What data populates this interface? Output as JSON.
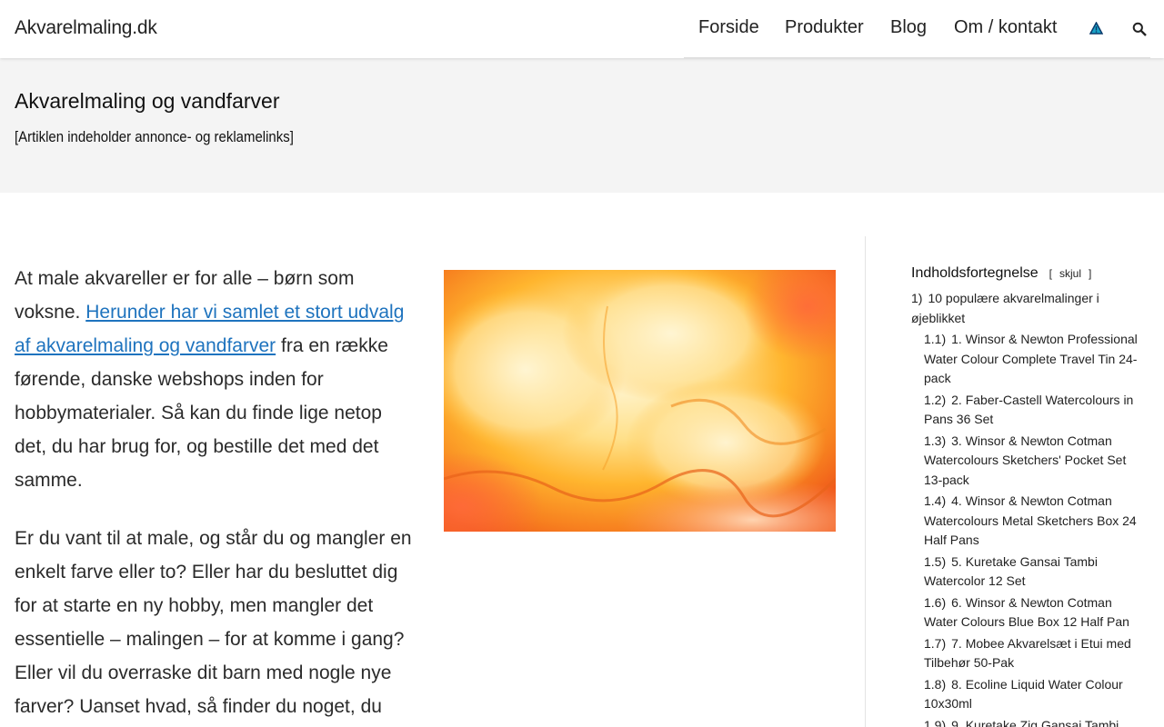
{
  "site": {
    "logo": "Akvarelmaling.dk"
  },
  "nav": {
    "items": [
      "Forside",
      "Produkter",
      "Blog",
      "Om / kontakt"
    ],
    "warn_icon": "warning-triangle-icon",
    "search_icon": "search-icon"
  },
  "hero": {
    "title": "Akvarelmaling og vandfarver",
    "subtitle": "[Artiklen indeholder annonce- og reklamelinks]"
  },
  "article": {
    "p1_before": "At male akvareller er for alle – børn som voksne. ",
    "p1_link": "Herunder har vi samlet et stort udvalg af akvarelmaling og vandfarver",
    "p1_after": " fra en række førende, danske webshops inden for hobbymaterialer. Så kan du finde lige netop det, du har brug for, og bestille det med det samme.",
    "p2": "Er du vant til at male, og står du og mangler en enkelt farve eller to? Eller har du besluttet dig for at starte en ny hobby, men mangler det essentielle – malingen – for at komme i gang? Eller vil du overraske dit barn med nogle nye farver? Uanset hvad, så finder du noget, du"
  },
  "toc": {
    "title": "Indholdsfortegnelse",
    "toggle_open": "[",
    "toggle_label": "skjul",
    "toggle_close": "]",
    "items": [
      {
        "num": "1)",
        "text": "10 populære akvarelmalinger i øjeblikket",
        "level": 1
      },
      {
        "num": "1.1)",
        "text": "1. Winsor & Newton Professional Water Colour Complete Travel Tin 24-pack",
        "level": 2
      },
      {
        "num": "1.2)",
        "text": "2. Faber-Castell Watercolours in Pans 36 Set",
        "level": 2
      },
      {
        "num": "1.3)",
        "text": "3. Winsor & Newton Cotman Watercolours Sketchers' Pocket Set 13-pack",
        "level": 2
      },
      {
        "num": "1.4)",
        "text": "4. Winsor & Newton Cotman Watercolours Metal Sketchers Box 24 Half Pans",
        "level": 2
      },
      {
        "num": "1.5)",
        "text": "5. Kuretake Gansai Tambi Watercolor 12 Set",
        "level": 2
      },
      {
        "num": "1.6)",
        "text": "6. Winsor & Newton Cotman Water Colours Blue Box 12 Half Pan",
        "level": 2
      },
      {
        "num": "1.7)",
        "text": "7. Mobee Akvarelsæt i Etui med Tilbehør 50-Pak",
        "level": 2
      },
      {
        "num": "1.8)",
        "text": "8. Ecoline Liquid Water Colour 10x30ml",
        "level": 2
      },
      {
        "num": "1.9)",
        "text": "9. Kuretake Zig Gansai Tambi",
        "level": 2
      }
    ]
  },
  "colors": {
    "link": "#1e73be",
    "hero_bg": "#f4f4f4",
    "accent_warn": "#1aa3c8"
  }
}
